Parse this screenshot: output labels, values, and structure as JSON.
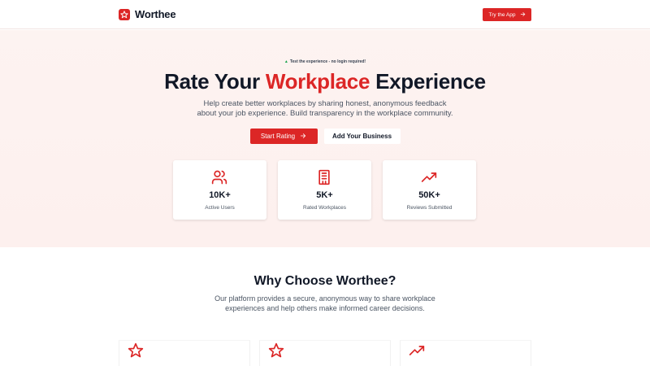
{
  "nav": {
    "brand": "Worthee",
    "cta_label": "Try the App",
    "logo_icon": "star-icon"
  },
  "hero": {
    "pill_text": "Test the experience - no login required!",
    "headline_prefix": "Rate Your ",
    "headline_accent": "Workplace",
    "headline_suffix": " Experience",
    "subtitle": "Help create better workplaces by sharing honest, anonymous feedback about your job experience. Build transparency in the workplace community.",
    "primary_cta": "Start Rating",
    "secondary_cta": "Add Your Business"
  },
  "stats": [
    {
      "value": "10K+",
      "label": "Active Users",
      "icon": "users-icon"
    },
    {
      "value": "5K+",
      "label": "Rated Workplaces",
      "icon": "building-icon"
    },
    {
      "value": "50K+",
      "label": "Reviews Submitted",
      "icon": "trending-up-icon"
    }
  ],
  "why": {
    "title": "Why Choose Worthee?",
    "subtitle": "Our platform provides a secure, anonymous way to share workplace experiences and help others make informed career decisions."
  },
  "features": [
    {
      "icon": "star-icon"
    },
    {
      "icon": "star-icon"
    },
    {
      "icon": "trending-up-icon"
    }
  ],
  "colors": {
    "accent": "#dc2626",
    "hero_bg": "#fdf2f0",
    "text": "#111827",
    "muted": "#4b5563"
  }
}
